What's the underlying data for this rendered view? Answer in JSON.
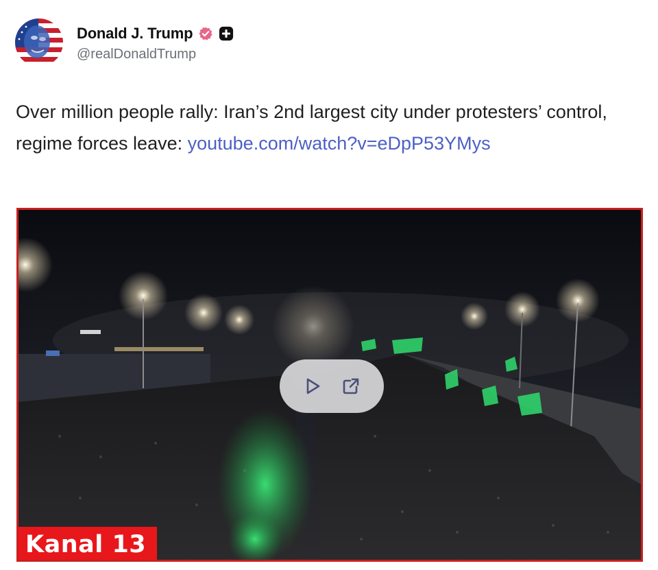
{
  "author": {
    "display_name": "Donald J. Trump",
    "handle": "@realDonaldTrump",
    "avatar_icon": "flag-portrait-avatar",
    "verified_icon": "verified-badge-icon",
    "verified_color": "#e8668a",
    "plus_icon": "plus-badge-icon"
  },
  "post": {
    "text": "Over million people rally: Iran’s 2nd largest city under protesters’ control, regime forces leave: ",
    "link_text": "youtube.com/watch?v=eDpP53YMys",
    "link_color": "#4c5fc7"
  },
  "video": {
    "thumbnail_description_icon": "night-crowd-scene",
    "play_icon": "play-icon",
    "external_icon": "open-external-icon",
    "channel_badge": "Kanal 13",
    "badge_color": "#e8171b",
    "border_color": "#c8201f"
  }
}
